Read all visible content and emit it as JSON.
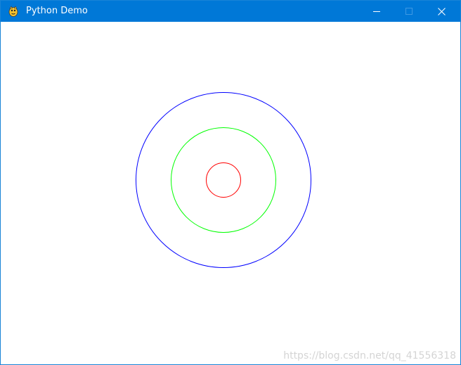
{
  "window": {
    "title": "Python Demo",
    "app_icon": "pygame-snake-icon",
    "controls": {
      "minimize_icon": "minimize-icon",
      "maximize_icon": "maximize-icon",
      "close_icon": "close-icon"
    }
  },
  "canvas": {
    "background": "#ffffff",
    "circles": [
      {
        "name": "outer-circle",
        "color": "#0000ff"
      },
      {
        "name": "middle-circle",
        "color": "#00ff00"
      },
      {
        "name": "inner-circle",
        "color": "#ff0000"
      }
    ]
  },
  "watermark": "https://blog.csdn.net/qq_41556318",
  "colors": {
    "titlebar": "#0078d7",
    "window_border": "#1883d7"
  }
}
